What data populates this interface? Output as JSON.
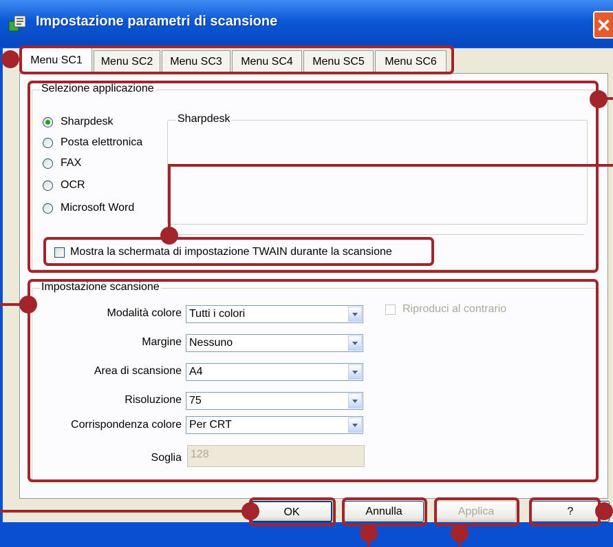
{
  "window": {
    "title": "Impostazione parametri di scansione",
    "close_symbol": "✕"
  },
  "tabs": [
    {
      "label": "Menu SC1",
      "active": true
    },
    {
      "label": "Menu SC2",
      "active": false
    },
    {
      "label": "Menu SC3",
      "active": false
    },
    {
      "label": "Menu SC4",
      "active": false
    },
    {
      "label": "Menu SC5",
      "active": false
    },
    {
      "label": "Menu SC6",
      "active": false
    }
  ],
  "app_selection": {
    "group_label": "Selezione applicazione",
    "options": [
      {
        "label": "Sharpdesk",
        "selected": true
      },
      {
        "label": "Posta elettronica",
        "selected": false
      },
      {
        "label": "FAX",
        "selected": false
      },
      {
        "label": "OCR",
        "selected": false
      },
      {
        "label": "Microsoft Word",
        "selected": false
      }
    ],
    "detail_group_label": "Sharpdesk",
    "twain_checkbox_label": "Mostra la schermata di impostazione TWAIN durante la scansione",
    "twain_checked": false
  },
  "scan_settings": {
    "group_label": "Impostazione scansione",
    "fields": [
      {
        "label": "Modalità colore",
        "value": "Tutti i colori"
      },
      {
        "label": "Margine",
        "value": "Nessuno"
      },
      {
        "label": "Area di scansione",
        "value": "A4"
      },
      {
        "label": "Risoluzione",
        "value": "75"
      },
      {
        "label": "Corrispondenza colore",
        "value": "Per CRT"
      }
    ],
    "threshold": {
      "label": "Soglia",
      "value": "128"
    },
    "reverse_checkbox_label": "Riproduci al contrario",
    "reverse_checked": false
  },
  "buttons": {
    "ok": "OK",
    "cancel": "Annulla",
    "apply": "Applica",
    "help": "?"
  },
  "colors": {
    "annotation": "#a3252b",
    "titlebar": "#0a57d6",
    "dialog_bg": "#ece9d8"
  },
  "icons": {
    "app": "scanner-settings-icon",
    "close": "close-icon"
  }
}
